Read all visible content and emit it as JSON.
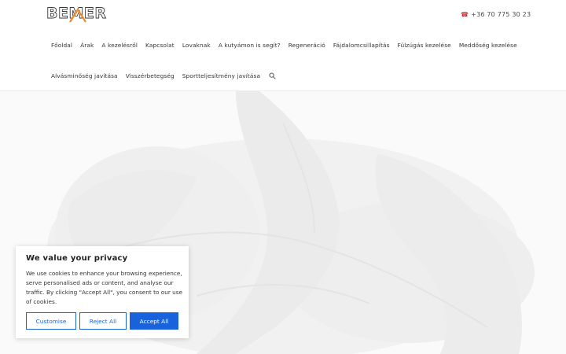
{
  "brand": {
    "logo_text": "BEMER",
    "accent": "#f28c28"
  },
  "header": {
    "phone": "+36 70 775 30 23",
    "phone_icon": "telephone-icon"
  },
  "nav": {
    "row1": [
      "Főoldal",
      "Árak",
      "A kezelésről",
      "Kapcsolat",
      "Lovaknak",
      "A kutyámon is segít?",
      "Regeneráció",
      "Fájdalomcsillapítás",
      "Fülzúgás kezelése",
      "Meddőség kezelése"
    ],
    "row2": [
      "Alvásminőség javítása",
      "Visszérbetegség",
      "Sportteljesítmény javítása"
    ],
    "search_icon": "search-icon"
  },
  "cookie": {
    "title": "We value your privacy",
    "text": "We use cookies to enhance your browsing experience, serve personalised ads or content, and analyse our traffic. By clicking \"Accept All\", you consent to our use of cookies.",
    "customise": "Customise",
    "reject": "Reject All",
    "accept": "Accept All",
    "accent": "#1863dc"
  }
}
